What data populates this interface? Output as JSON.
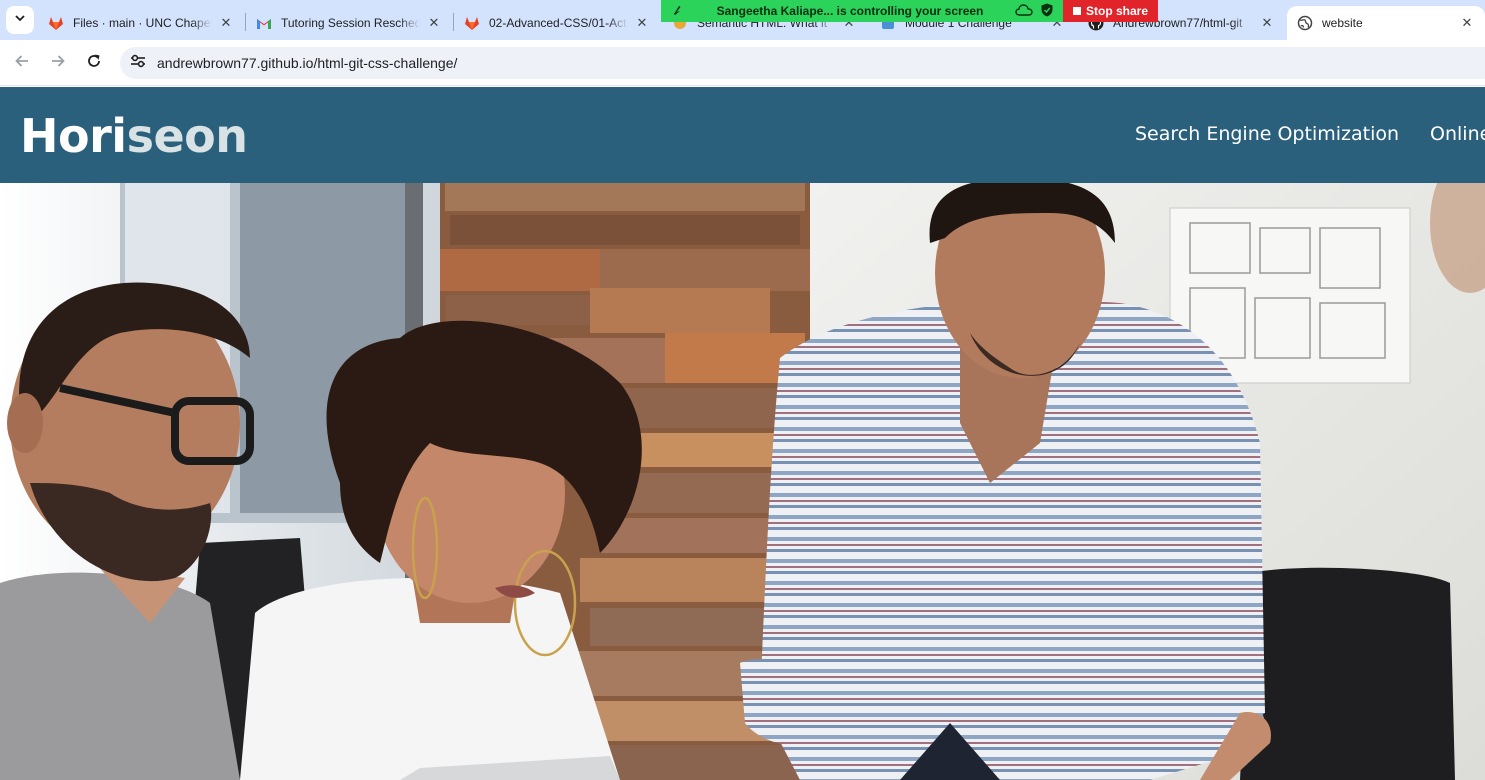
{
  "browser": {
    "tabs": [
      {
        "title": "Files · main · UNC Chapel",
        "icon": "gitlab-icon"
      },
      {
        "title": "Tutoring Session Resched",
        "icon": "gmail-icon"
      },
      {
        "title": "02-Advanced-CSS/01-Act",
        "icon": "gitlab-icon"
      },
      {
        "title": "Semantic HTML: What it",
        "icon": "page-icon"
      },
      {
        "title": "Module 1 Challenge",
        "icon": "page-icon"
      },
      {
        "title": "Andrewbrown77/html-git",
        "icon": "github-icon"
      },
      {
        "title": "website",
        "icon": "globe-icon"
      }
    ],
    "active_tab_index": 6,
    "url": "andrewbrown77.github.io/html-git-css-challenge/"
  },
  "share_banner": {
    "text": "Sangeetha Kaliape... is controlling your screen",
    "stop_label": "Stop share"
  },
  "site": {
    "logo_main": "Hori",
    "logo_accent": "seon",
    "nav": [
      "Search Engine Optimization",
      "Online Reputation Management"
    ],
    "hero_image": "team-working-at-laptop-photo"
  },
  "colors": {
    "header_bg": "#2a607c",
    "tabstrip_bg": "#d3e3fd",
    "share_green": "#2bd35a",
    "stop_red": "#e0242a"
  }
}
